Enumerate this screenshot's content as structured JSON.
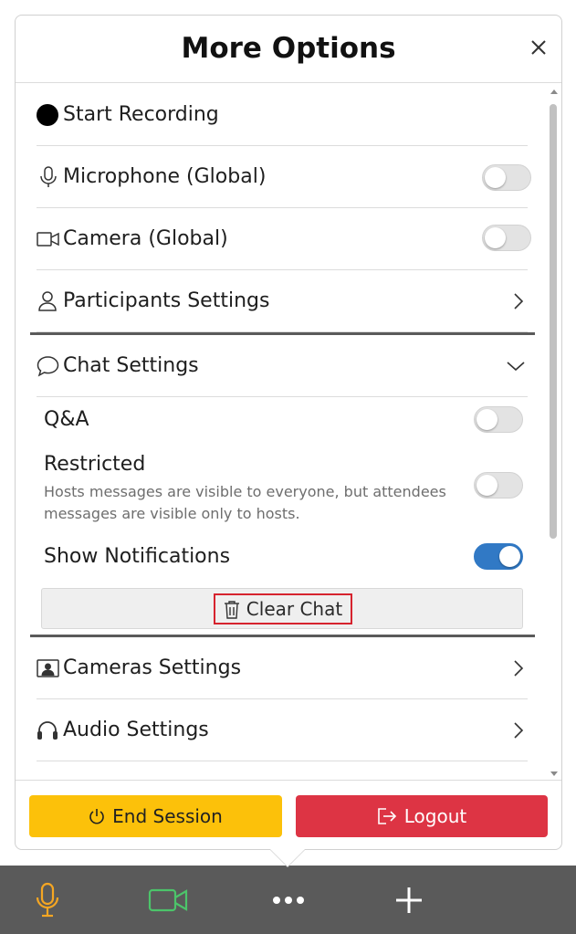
{
  "dialog": {
    "title": "More Options",
    "close_icon": "close-icon"
  },
  "menu": {
    "start_recording": {
      "label": "Start Recording",
      "icon": "record-dot-icon"
    },
    "microphone": {
      "label": "Microphone (Global)",
      "icon": "microphone-icon",
      "enabled": false
    },
    "camera": {
      "label": "Camera (Global)",
      "icon": "video-camera-icon",
      "enabled": false
    },
    "participants": {
      "label": "Participants Settings",
      "icon": "person-icon"
    },
    "chat": {
      "label": "Chat Settings",
      "icon": "chat-bubble-icon",
      "expanded": true,
      "qa": {
        "label": "Q&A",
        "enabled": false
      },
      "restricted": {
        "label": "Restricted",
        "description": "Hosts messages are visible to everyone, but attendees messages are visible only to hosts.",
        "enabled": false
      },
      "notifications": {
        "label": "Show Notifications",
        "enabled": true
      },
      "clear_chat": {
        "label": "Clear Chat",
        "icon": "trash-icon"
      }
    },
    "cameras_settings": {
      "label": "Cameras Settings",
      "icon": "camera-frame-icon"
    },
    "audio_settings": {
      "label": "Audio Settings",
      "icon": "headphones-icon"
    }
  },
  "footer": {
    "end_session": {
      "label": "End Session",
      "icon": "power-icon",
      "color": "#fcc10a"
    },
    "logout": {
      "label": "Logout",
      "icon": "logout-icon",
      "color": "#dd3444"
    }
  },
  "bottom_bar": {
    "background": "#5a5a5a",
    "items": [
      {
        "name": "microphone-icon",
        "color": "#f5a623"
      },
      {
        "name": "video-camera-icon",
        "color": "#4cc46a"
      },
      {
        "name": "more-dots-icon",
        "color": "#ffffff"
      },
      {
        "name": "plus-icon",
        "color": "#ffffff"
      }
    ]
  },
  "colors": {
    "toggle_on": "#3179c5",
    "highlight_box": "#d6232e"
  }
}
